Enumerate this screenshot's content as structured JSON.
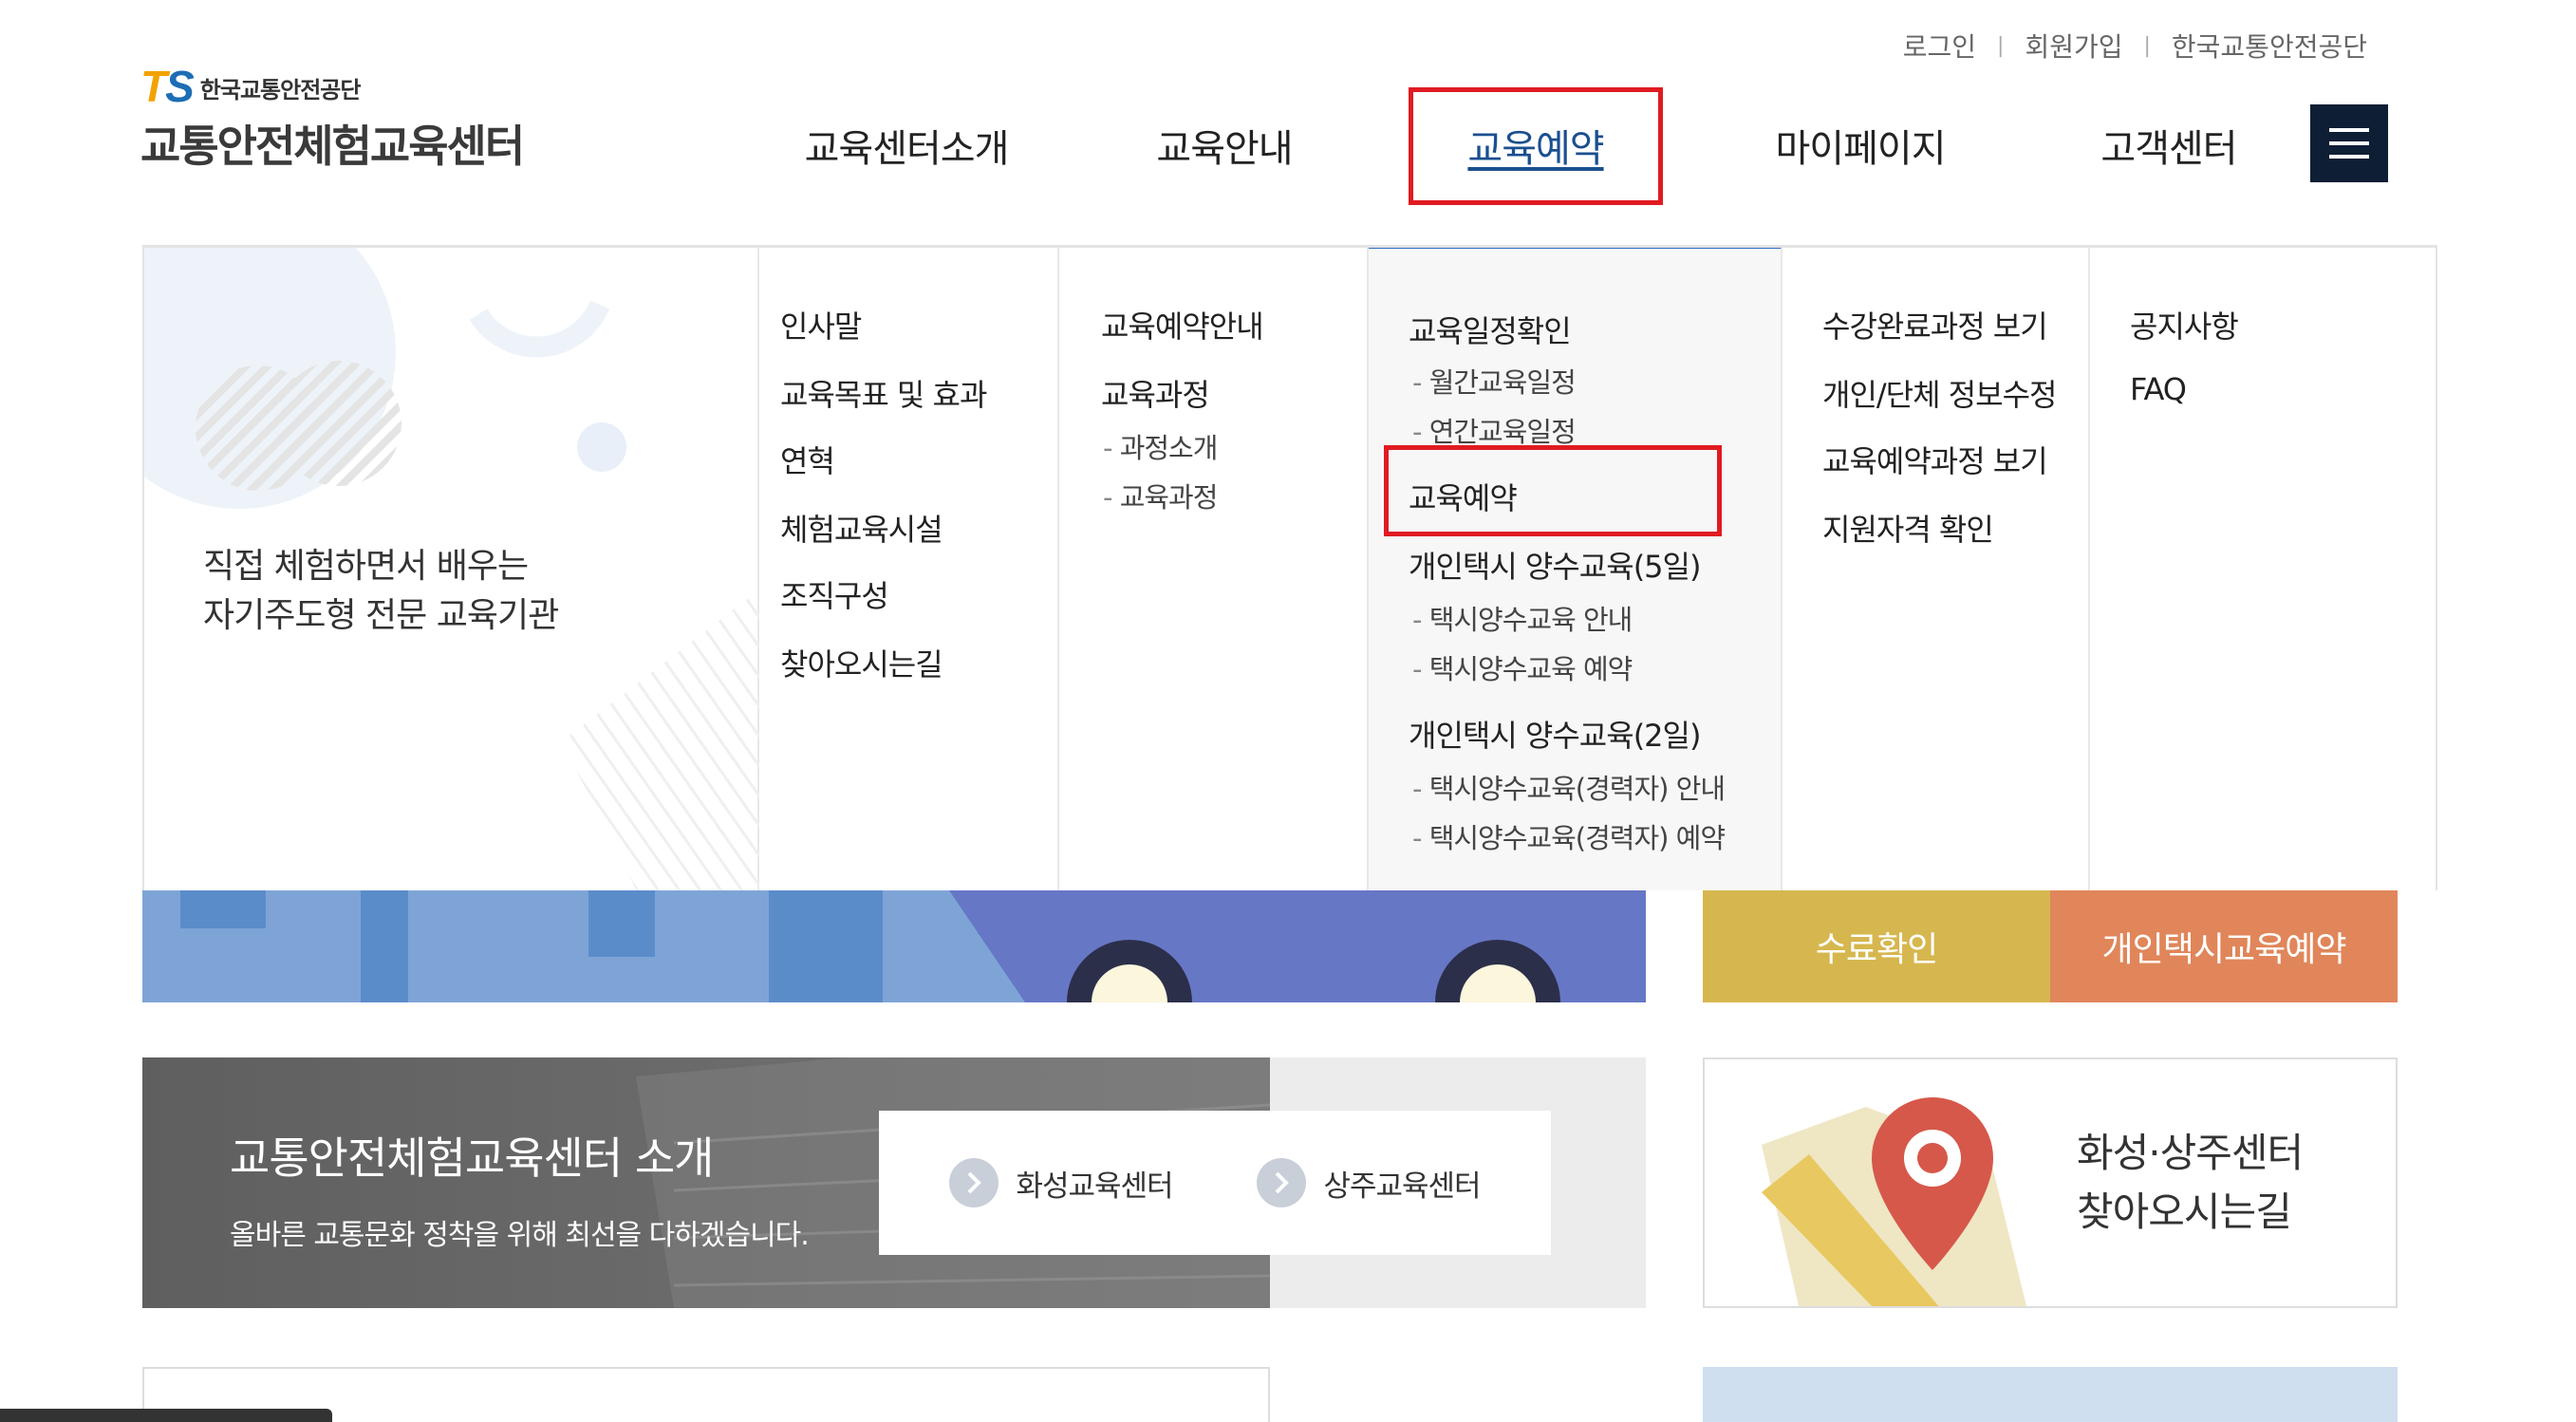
{
  "util_links": [
    "로그인",
    "회원가입",
    "한국교통안전공단"
  ],
  "logo": {
    "ts_t": "T",
    "ts_s": "S",
    "org_name": "한국교통안전공단",
    "center_name": "교통안전체험교육센터"
  },
  "gnb": [
    "교육센터소개",
    "교육안내",
    "교육예약",
    "마이페이지",
    "고객센터"
  ],
  "menu_icon": "hamburger-icon",
  "mega_menu": {
    "intro_lines": [
      "직접 체험하면서 배우는",
      "자기주도형 전문 교육기관"
    ],
    "col1": [
      "인사말",
      "교육목표 및 효과",
      "연혁",
      "체험교육시설",
      "조직구성",
      "찾아오시는길"
    ],
    "col2": {
      "items": [
        "교육예약안내",
        "교육과정"
      ],
      "subs": [
        "과정소개",
        "교육과정"
      ]
    },
    "col3": {
      "schedule": "교육일정확인",
      "schedule_subs": [
        "월간교육일정",
        "연간교육일정"
      ],
      "reserve": "교육예약",
      "taxi5": "개인택시 양수교육(5일)",
      "taxi5_subs": [
        "택시양수교육 안내",
        "택시양수교육 예약"
      ],
      "taxi2": "개인택시 양수교육(2일)",
      "taxi2_subs": [
        "택시양수교육(경력자) 안내",
        "택시양수교육(경력자) 예약"
      ]
    },
    "col4": [
      "수강완료과정 보기",
      "개인/단체 정보수정",
      "교육예약과정 보기",
      "지원자격 확인"
    ],
    "col5": [
      "공지사항",
      "FAQ"
    ]
  },
  "quick_buttons": [
    {
      "label": "수료확인",
      "color": "#d6b74f"
    },
    {
      "label": "개인택시교육예약",
      "color": "#e0865a"
    }
  ],
  "intro_box": {
    "title": "교통안전체험교육센터 소개",
    "subtitle": "올바른 교통문화 정착을 위해 최선을 다하겠습니다.",
    "links": [
      "화성교육센터",
      "상주교육센터"
    ]
  },
  "map_box": {
    "lines": [
      "화성·상주센터",
      "찾아오시는길"
    ]
  },
  "colors": {
    "navy": "#0d1e35",
    "highlight_red": "#e01b22",
    "active_blue": "#2f6fc0"
  }
}
